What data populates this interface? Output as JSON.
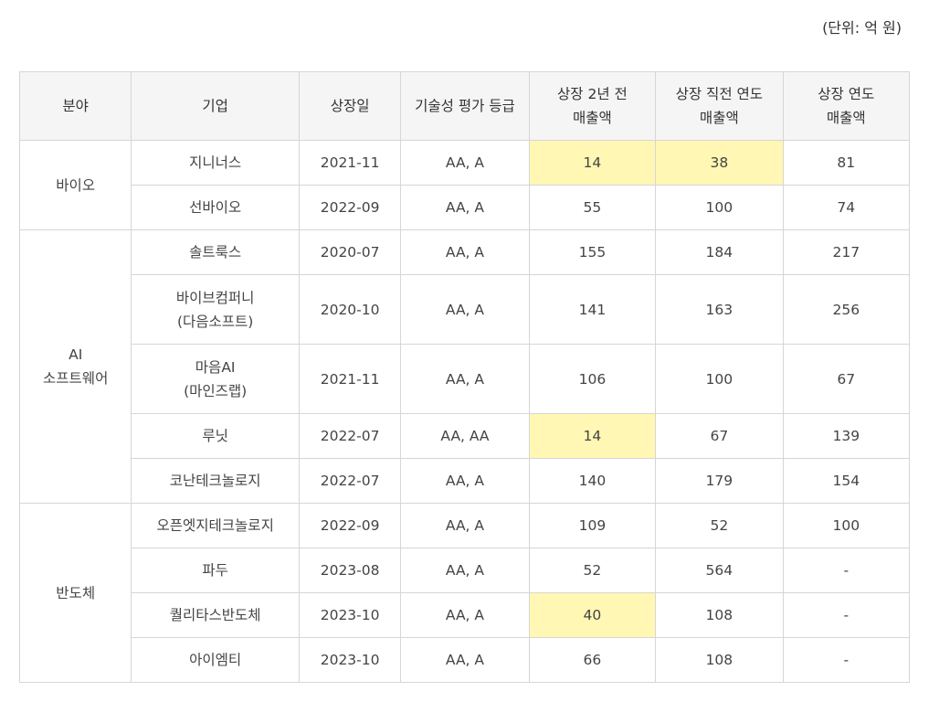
{
  "unit_note": "(단위: 억 원)",
  "headers": {
    "field": "분야",
    "company": "기업",
    "listing_date": "상장일",
    "tech_grade": "기술성 평가 등급",
    "revenue_2y_before": "상장 2년 전\n매출액",
    "revenue_year_before": "상장 직전 연도\n매출액",
    "revenue_listing_year": "상장 연도\n매출액"
  },
  "groups": [
    {
      "field": "바이오",
      "rows": [
        {
          "company": "지니너스",
          "date": "2021-11",
          "grade": "AA, A",
          "rev_2y": "14",
          "rev_prev": "38",
          "rev_year": "81",
          "hl_2y": true,
          "hl_prev": true
        },
        {
          "company": "선바이오",
          "date": "2022-09",
          "grade": "AA, A",
          "rev_2y": "55",
          "rev_prev": "100",
          "rev_year": "74",
          "hl_2y": false,
          "hl_prev": false
        }
      ]
    },
    {
      "field": "AI\n소프트웨어",
      "rows": [
        {
          "company": "솔트룩스",
          "date": "2020-07",
          "grade": "AA, A",
          "rev_2y": "155",
          "rev_prev": "184",
          "rev_year": "217",
          "hl_2y": false,
          "hl_prev": false
        },
        {
          "company": "바이브컴퍼니\n(다음소프트)",
          "date": "2020-10",
          "grade": "AA, A",
          "rev_2y": "141",
          "rev_prev": "163",
          "rev_year": "256",
          "hl_2y": false,
          "hl_prev": false,
          "tall": true
        },
        {
          "company": "마음AI\n(마인즈랩)",
          "date": "2021-11",
          "grade": "AA, A",
          "rev_2y": "106",
          "rev_prev": "100",
          "rev_year": "67",
          "hl_2y": false,
          "hl_prev": false,
          "tall": true
        },
        {
          "company": "루닛",
          "date": "2022-07",
          "grade": "AA, AA",
          "rev_2y": "14",
          "rev_prev": "67",
          "rev_year": "139",
          "hl_2y": true,
          "hl_prev": false
        },
        {
          "company": "코난테크놀로지",
          "date": "2022-07",
          "grade": "AA, A",
          "rev_2y": "140",
          "rev_prev": "179",
          "rev_year": "154",
          "hl_2y": false,
          "hl_prev": false
        }
      ]
    },
    {
      "field": "반도체",
      "rows": [
        {
          "company": "오픈엣지테크놀로지",
          "date": "2022-09",
          "grade": "AA, A",
          "rev_2y": "109",
          "rev_prev": "52",
          "rev_year": "100",
          "hl_2y": false,
          "hl_prev": false
        },
        {
          "company": "파두",
          "date": "2023-08",
          "grade": "AA, A",
          "rev_2y": "52",
          "rev_prev": "564",
          "rev_year": "-",
          "hl_2y": false,
          "hl_prev": false
        },
        {
          "company": "퀄리타스반도체",
          "date": "2023-10",
          "grade": "AA, A",
          "rev_2y": "40",
          "rev_prev": "108",
          "rev_year": "-",
          "hl_2y": true,
          "hl_prev": false
        },
        {
          "company": "아이엠티",
          "date": "2023-10",
          "grade": "AA, A",
          "rev_2y": "66",
          "rev_prev": "108",
          "rev_year": "-",
          "hl_2y": false,
          "hl_prev": false
        }
      ]
    }
  ],
  "colors": {
    "highlight": "#fff7b3",
    "header_bg": "#f5f5f5",
    "border": "#d6d6d6"
  }
}
